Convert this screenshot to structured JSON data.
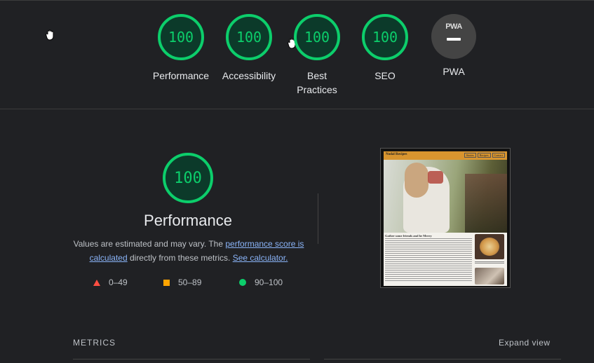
{
  "colors": {
    "pass": "#0cce6b",
    "average": "#ffa400",
    "fail": "#ff4e42",
    "background": "#202124",
    "link": "#8ab4f8"
  },
  "gauges": [
    {
      "score": "100",
      "label": "Performance"
    },
    {
      "score": "100",
      "label": "Accessibility"
    },
    {
      "score": "100",
      "label": "Best Practices"
    },
    {
      "score": "100",
      "label": "SEO"
    },
    {
      "label": "PWA",
      "badge": "PWA"
    }
  ],
  "main": {
    "score": "100",
    "title": "Performance",
    "desc_prefix": "Values are estimated and may vary. The ",
    "link_score": "performance score is calculated",
    "desc_middle": " directly from these metrics. ",
    "link_calculator": "See calculator."
  },
  "legend": [
    {
      "icon": "triangle-icon",
      "range": "0–49"
    },
    {
      "icon": "square-icon",
      "range": "50–89"
    },
    {
      "icon": "circle-icon",
      "range": "90–100"
    }
  ],
  "screenshot": {
    "brand": "Nodal Recipes",
    "nav": [
      "Stories",
      "Recipes",
      "Contact"
    ],
    "heading": "Gather some friends and be Merry"
  },
  "metrics": {
    "heading": "METRICS",
    "expand": "Expand view"
  }
}
